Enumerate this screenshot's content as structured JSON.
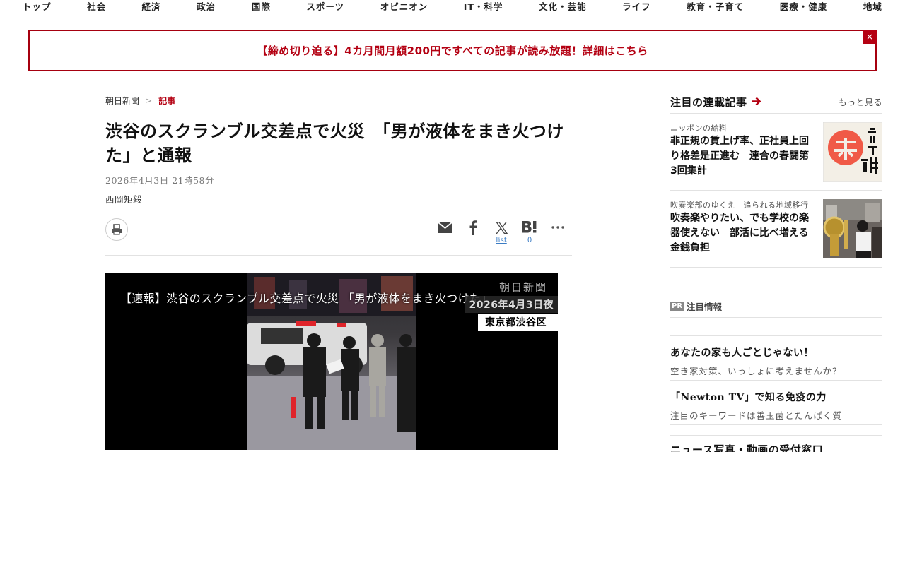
{
  "nav": {
    "items": [
      "トップ",
      "社会",
      "経済",
      "政治",
      "国際",
      "スポーツ",
      "オピニオン",
      "IT・科学",
      "文化・芸能",
      "ライフ",
      "教育・子育て",
      "医療・健康",
      "地域"
    ]
  },
  "banner": {
    "text": "【締め切り迫る】4カ月間月額200円ですべての記事が読み放題！詳細はこちら",
    "close": "×"
  },
  "breadcrumb": {
    "home": "朝日新聞",
    "sep": ">",
    "current": "記事"
  },
  "article": {
    "headline": "渋谷のスクランブル交差点で火災　「男が液体をまき火つけた」と通報",
    "date": "2026年4月3日 21時58分",
    "author": "西岡矩毅"
  },
  "share": {
    "x_count": "list",
    "hatena_count": "0"
  },
  "video": {
    "title": "【速報】渋谷のスクランブル交差点で火災 「男が液体をまき火つけた」",
    "brand": "朝日新聞",
    "date": "2026年4月3日夜",
    "place": "東京都渋谷区"
  },
  "sidebar": {
    "title": "注目の連載記事",
    "more": "もっと見る",
    "series": [
      {
        "kicker": "ニッポンの給料",
        "title": "非正規の賃上げ率、正社員上回り格差是正進む　連合の春闘第3回集計",
        "thumb_text": "ニッポンの給料"
      },
      {
        "kicker": "吹奏楽部のゆくえ　追られる地域移行",
        "title": "吹奏楽やりたい、でも学校の楽器使えない　部活に比べ増える金銭負担"
      }
    ],
    "pr": {
      "badge": "PR",
      "label": "注目情報",
      "items": [
        {
          "title": "あなたの家も人ごとじゃない！",
          "sub": "空き家対策、いっしょに考えませんか？"
        },
        {
          "title": "「Newton TV」で知る免疫の力",
          "sub": "注目のキーワードは善玉菌とたんぱく質"
        }
      ]
    },
    "news_heading": "ニュース写真・動画の受付窓口"
  },
  "colors": {
    "accent": "#b40012",
    "link": "#3b7cc4"
  }
}
